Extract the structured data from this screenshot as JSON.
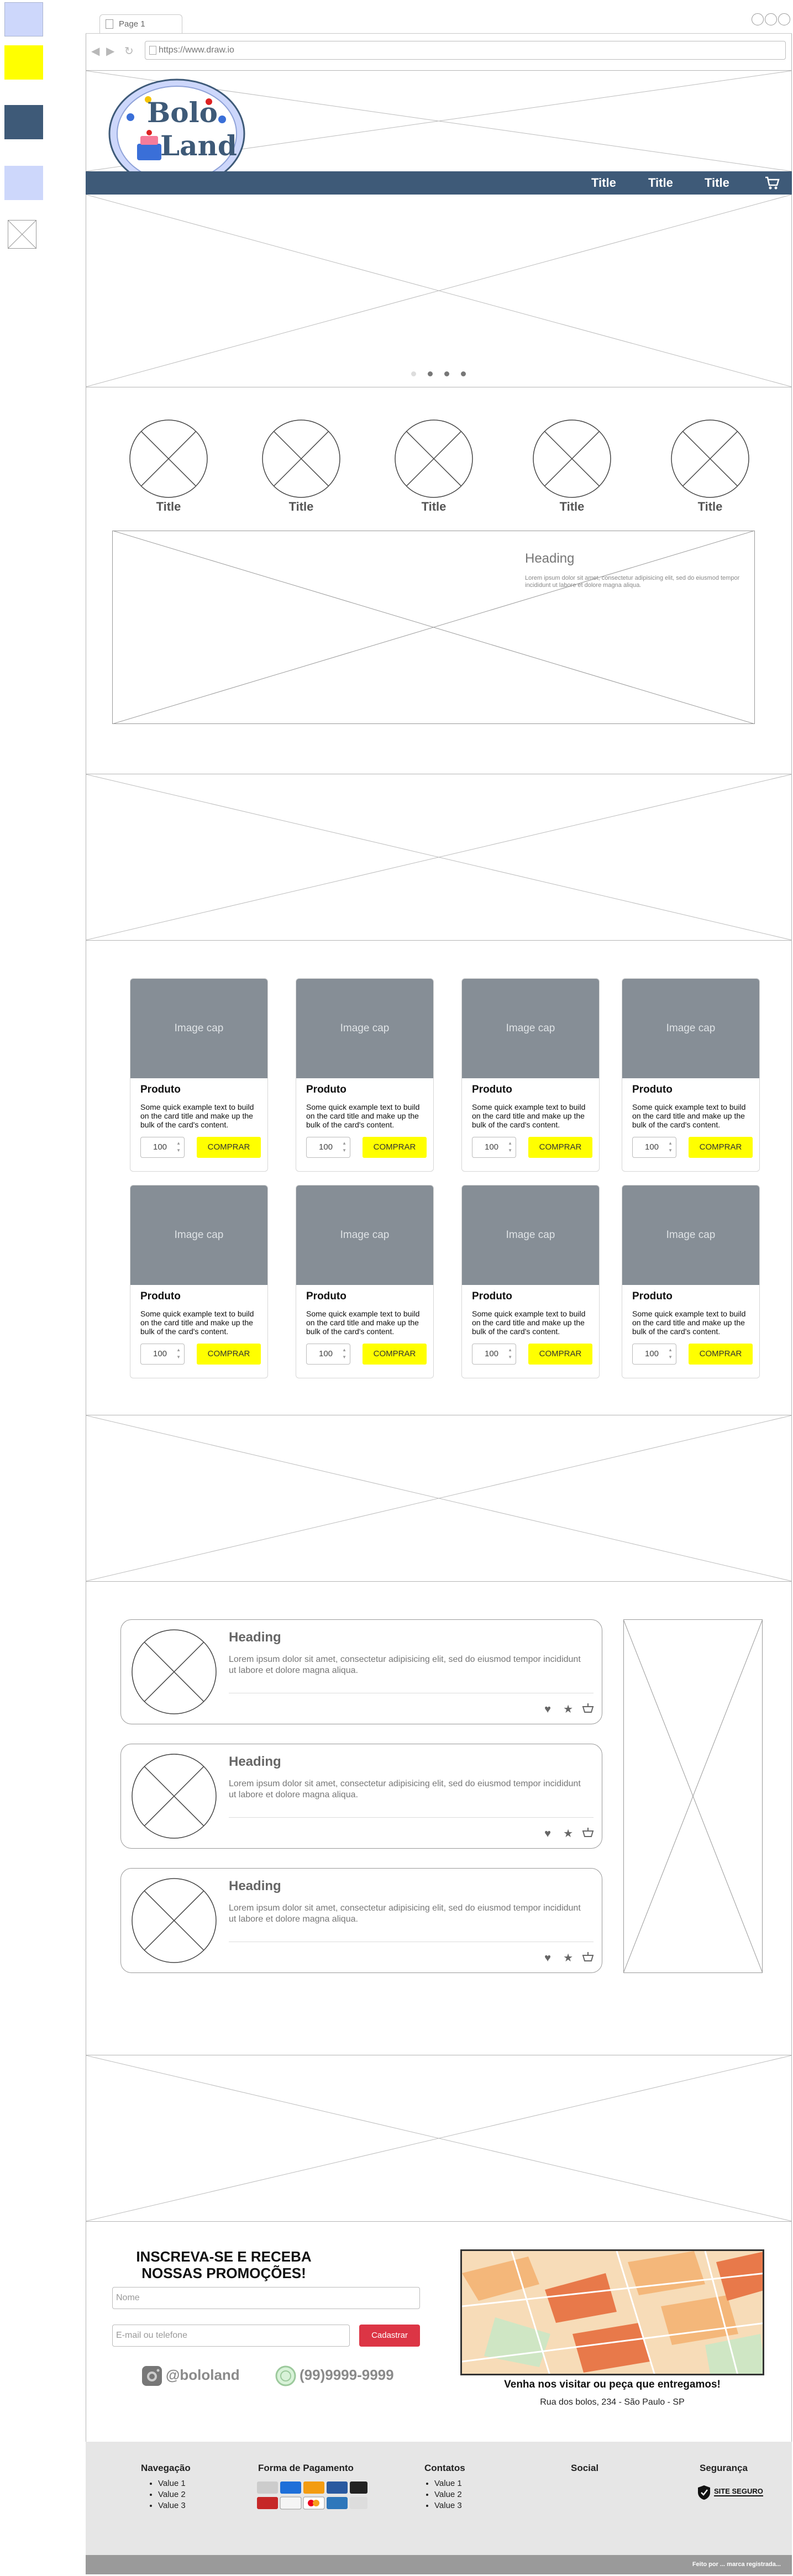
{
  "colors": {
    "accent_blue": "#3e5a78",
    "light_blue": "#cdd7fb",
    "yellow": "#ffff00",
    "red": "#dc3545",
    "placeholder_gray": "#868e96"
  },
  "browser": {
    "tab_title": "Page 1",
    "url": "https://www.draw.io"
  },
  "logo": {
    "line1": "Bolo",
    "line2": "Land"
  },
  "nav": {
    "items": [
      "Title",
      "Title",
      "Title"
    ],
    "cart_icon": "cart-icon"
  },
  "categories": {
    "titles": [
      "Title",
      "Title",
      "Title",
      "Title",
      "Title"
    ]
  },
  "feature": {
    "heading": "Heading",
    "text": "Lorem ipsum dolor sit amet, consectetur adipisicing elit, sed do eiusmod tempor incididunt ut labore et dolore magna aliqua."
  },
  "products": {
    "items": [
      {
        "image": "Image cap",
        "title": "Produto",
        "text": "Some quick example text to build on the card title and make up the bulk of the card's content.",
        "qty": "100",
        "button": "COMPRAR"
      },
      {
        "image": "Image cap",
        "title": "Produto",
        "text": "Some quick example text to build on the card title and make up the bulk of the card's content.",
        "qty": "100",
        "button": "COMPRAR"
      },
      {
        "image": "Image cap",
        "title": "Produto",
        "text": "Some quick example text to build on the card title and make up the bulk of the card's content.",
        "qty": "100",
        "button": "COMPRAR"
      },
      {
        "image": "Image cap",
        "title": "Produto",
        "text": "Some quick example text to build on the card title and make up the bulk of the card's content.",
        "qty": "100",
        "button": "COMPRAR"
      },
      {
        "image": "Image cap",
        "title": "Produto",
        "text": "Some quick example text to build on the card title and make up the bulk of the card's content.",
        "qty": "100",
        "button": "COMPRAR"
      },
      {
        "image": "Image cap",
        "title": "Produto",
        "text": "Some quick example text to build on the card title and make up the bulk of the card's content.",
        "qty": "100",
        "button": "COMPRAR"
      },
      {
        "image": "Image cap",
        "title": "Produto",
        "text": "Some quick example text to build on the card title and make up the bulk of the card's content.",
        "qty": "100",
        "button": "COMPRAR"
      },
      {
        "image": "Image cap",
        "title": "Produto",
        "text": "Some quick example text to build on the card title and make up the bulk of the card's content.",
        "qty": "100",
        "button": "COMPRAR"
      }
    ]
  },
  "reviews": [
    {
      "heading": "Heading",
      "text": "Lorem ipsum dolor sit amet, consectetur adipisicing elit, sed do eiusmod tempor incididunt ut labore et dolore magna aliqua.",
      "icons": [
        "heart-icon",
        "star-icon",
        "basket-icon"
      ]
    },
    {
      "heading": "Heading",
      "text": "Lorem ipsum dolor sit amet, consectetur adipisicing elit, sed do eiusmod tempor incididunt ut labore et dolore magna aliqua.",
      "icons": [
        "heart-icon",
        "star-icon",
        "basket-icon"
      ]
    },
    {
      "heading": "Heading",
      "text": "Lorem ipsum dolor sit amet, consectetur adipisicing elit, sed do eiusmod tempor incididunt ut labore et dolore magna aliqua.",
      "icons": [
        "heart-icon",
        "star-icon",
        "basket-icon"
      ]
    }
  ],
  "newsletter": {
    "title": "INSCREVA-SE E RECEBA NOSSAS PROMOÇÕES!",
    "name_placeholder": "Nome",
    "contact_placeholder": "E-mail ou telefone",
    "button": "Cadastrar"
  },
  "social": {
    "instagram": "@bololand",
    "whatsapp": "(99)9999-9999"
  },
  "visit": {
    "title": "Venha nos visitar ou peça que entregamos!",
    "address": "Rua dos bolos, 234 - São Paulo - SP"
  },
  "footer": {
    "navegacao": {
      "title": "Navegação",
      "items": [
        "Value 1",
        "Value 2",
        "Value 3"
      ]
    },
    "pagamento": {
      "title": "Forma de Pagamento"
    },
    "contatos": {
      "title": "Contatos",
      "items": [
        "Value 1",
        "Value 2",
        "Value 3"
      ]
    },
    "social": {
      "title": "Social"
    },
    "seguranca": {
      "title": "Segurança",
      "badge": "SITE SEGURO"
    },
    "bottom_text": "Feito por ... marca registrada..."
  }
}
